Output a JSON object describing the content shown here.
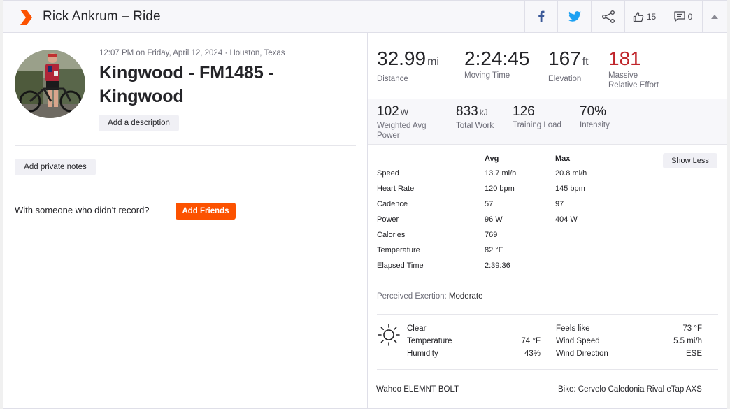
{
  "header": {
    "title": "Rick Ankrum – Ride",
    "kudos_count": "15",
    "comments_count": "0"
  },
  "activity": {
    "meta": "12:07 PM on Friday, April 12, 2024 · Houston, Texas",
    "title": "Kingwood - FM1485 - Kingwood",
    "add_description": "Add a description",
    "add_private_notes": "Add private notes",
    "with_someone": "With someone who didn't record?",
    "add_friends": "Add Friends"
  },
  "top_stats": [
    {
      "value": "32.99",
      "unit": "mi",
      "label": "Distance"
    },
    {
      "value": "2:24:45",
      "unit": "",
      "label": "Moving Time"
    },
    {
      "value": "167",
      "unit": "ft",
      "label": "Elevation"
    },
    {
      "value": "181",
      "unit": "",
      "label": "Massive",
      "label2": "Relative Effort"
    }
  ],
  "mid_stats": [
    {
      "value": "102",
      "unit": "W",
      "label": "Weighted Avg",
      "label2": "Power"
    },
    {
      "value": "833",
      "unit": "kJ",
      "label": "Total Work"
    },
    {
      "value": "126",
      "unit": "",
      "label": "Training Load"
    },
    {
      "value": "70%",
      "unit": "",
      "label": "Intensity"
    }
  ],
  "details": {
    "avg_header": "Avg",
    "max_header": "Max",
    "show_less": "Show Less",
    "rows": [
      {
        "label": "Speed",
        "avg": "13.7 mi/h",
        "max": "20.8 mi/h"
      },
      {
        "label": "Heart Rate",
        "avg": "120 bpm",
        "max": "145 bpm"
      },
      {
        "label": "Cadence",
        "avg": "57",
        "max": "97"
      },
      {
        "label": "Power",
        "avg": "96 W",
        "max": "404 W"
      },
      {
        "label": "Calories",
        "avg": "769",
        "max": ""
      },
      {
        "label": "Temperature",
        "avg": "82 °F",
        "max": ""
      },
      {
        "label": "Elapsed Time",
        "avg": "2:39:36",
        "max": ""
      }
    ]
  },
  "exertion": {
    "label": "Perceived Exertion:",
    "value": "Moderate"
  },
  "weather": {
    "icon": "sun-icon",
    "condition": "Clear",
    "temperature_label": "Temperature",
    "temperature": "74 °F",
    "humidity_label": "Humidity",
    "humidity": "43%",
    "feels_like_label": "Feels like",
    "feels_like": "73 °F",
    "wind_speed_label": "Wind Speed",
    "wind_speed": "5.5 mi/h",
    "wind_direction_label": "Wind Direction",
    "wind_direction": "ESE"
  },
  "device": "Wahoo ELEMNT BOLT",
  "bike": "Bike: Cervelo Caledonia Rival eTap AXS",
  "colors": {
    "brand": "#fc5200",
    "relative_effort": "#c0252b",
    "facebook": "#3b5998",
    "twitter": "#1da1f2"
  }
}
